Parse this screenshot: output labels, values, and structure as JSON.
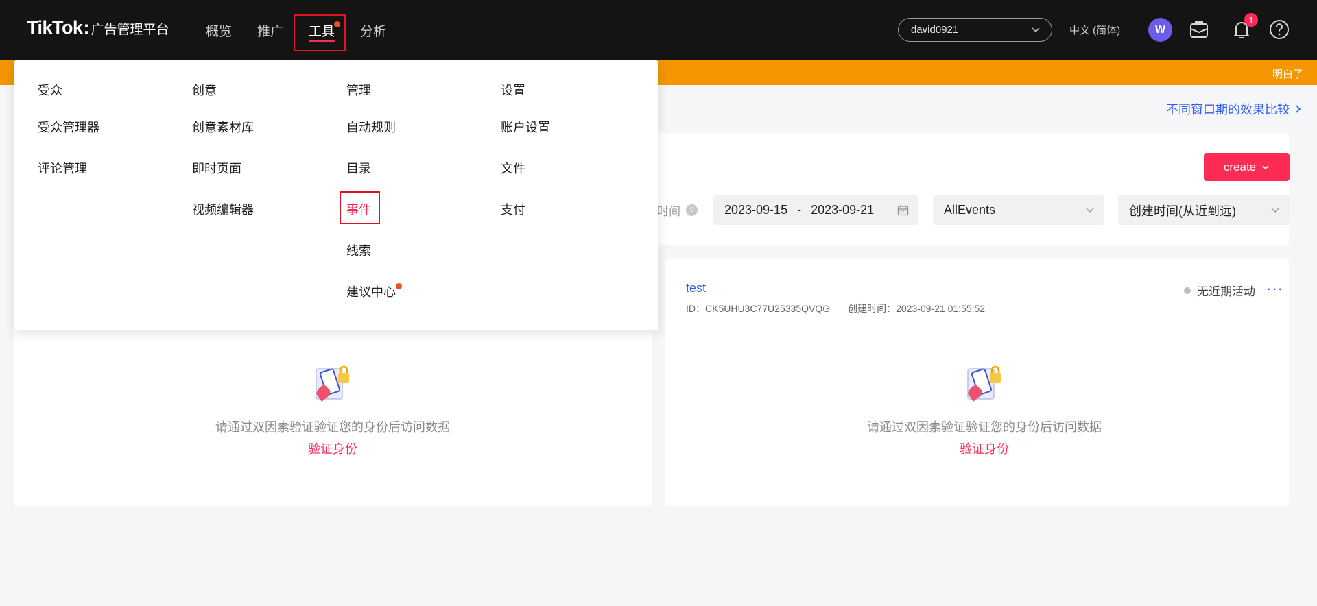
{
  "header": {
    "brand": "TikTok",
    "product": "广告管理平台",
    "nav": [
      {
        "label": "概览"
      },
      {
        "label": "推广"
      },
      {
        "label": "工具",
        "active": true,
        "has_dot": true
      },
      {
        "label": "分析"
      }
    ],
    "account_select": "david0921",
    "language": "中文 (简体)",
    "avatar_initial": "W",
    "notification_count": "1",
    "icons": [
      "briefcase-icon",
      "bell-icon",
      "help-icon"
    ]
  },
  "banner": {
    "color": "#f39600",
    "dismiss_label": "明白了"
  },
  "tools_menu": {
    "columns": [
      {
        "heading": "受众",
        "items": [
          "受众管理器",
          "评论管理"
        ]
      },
      {
        "heading": "创意",
        "items": [
          "创意素材库",
          "即时页面",
          "视频编辑器"
        ]
      },
      {
        "heading": "管理",
        "items": [
          "自动规则",
          "目录",
          "事件",
          "线索",
          "建议中心"
        ]
      },
      {
        "heading": "设置",
        "items": [
          "账户设置",
          "文件",
          "支付"
        ]
      }
    ],
    "selected_item": "事件",
    "dot_item": "建议中心"
  },
  "main": {
    "compare_link": "不同窗口期的效果比较",
    "create_button": "create",
    "time_label": "时间",
    "date_start": "2023-09-15",
    "date_separator": "-",
    "date_end": "2023-09-21",
    "event_filter": "AllEvents",
    "sort_filter": "创建时间(从近到远)",
    "event_card": {
      "name": "test",
      "id_text": "ID：CK5UHU3C77U25335QVQG",
      "created_text": "创建时间：2023-09-21 01:55:52",
      "status": "无近期活动",
      "more": "···"
    },
    "verify_message": "请通过双因素验证验证您的身份后访问数据",
    "verify_link": "验证身份"
  },
  "colors": {
    "accent": "#fe2c55",
    "link": "#2f5cf6",
    "topbar": "#141414",
    "highlight": "#e0141e"
  }
}
